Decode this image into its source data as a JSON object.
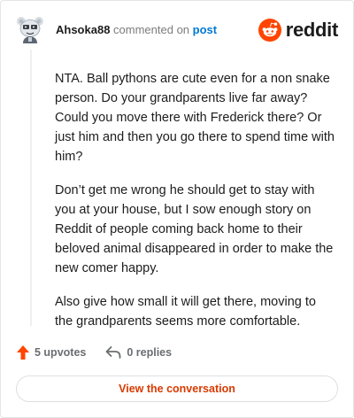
{
  "header": {
    "username": "Ahsoka88",
    "commented_on": "commented on",
    "post_link": "post"
  },
  "logo": {
    "wordmark": "reddit",
    "brand_color": "#ff4500"
  },
  "comment": {
    "paragraphs": [
      "NTA. Ball pythons are cute even for a non snake person. Do your grandparents live far away? Could you move there with Frederick there? Or just him and then you go there to spend time with him?",
      "Don’t get me wrong he should get to stay with you at your house, but I sow enough story on Reddit of people coming back home to their beloved animal disappeared in order to make the new comer happy.",
      "Also give how small it will get there, moving to the grandparents seems more comfortable."
    ]
  },
  "actions": {
    "upvotes": "5 upvotes",
    "replies": "0 replies",
    "upvote_color": "#ff4500"
  },
  "cta": {
    "label": "View the conversation",
    "color": "#d93a00"
  },
  "icons": {
    "avatar": "snoo-avatar-icon",
    "logo": "reddit-logo-icon",
    "upvote": "upvote-arrow-icon",
    "reply": "reply-arrow-icon"
  }
}
